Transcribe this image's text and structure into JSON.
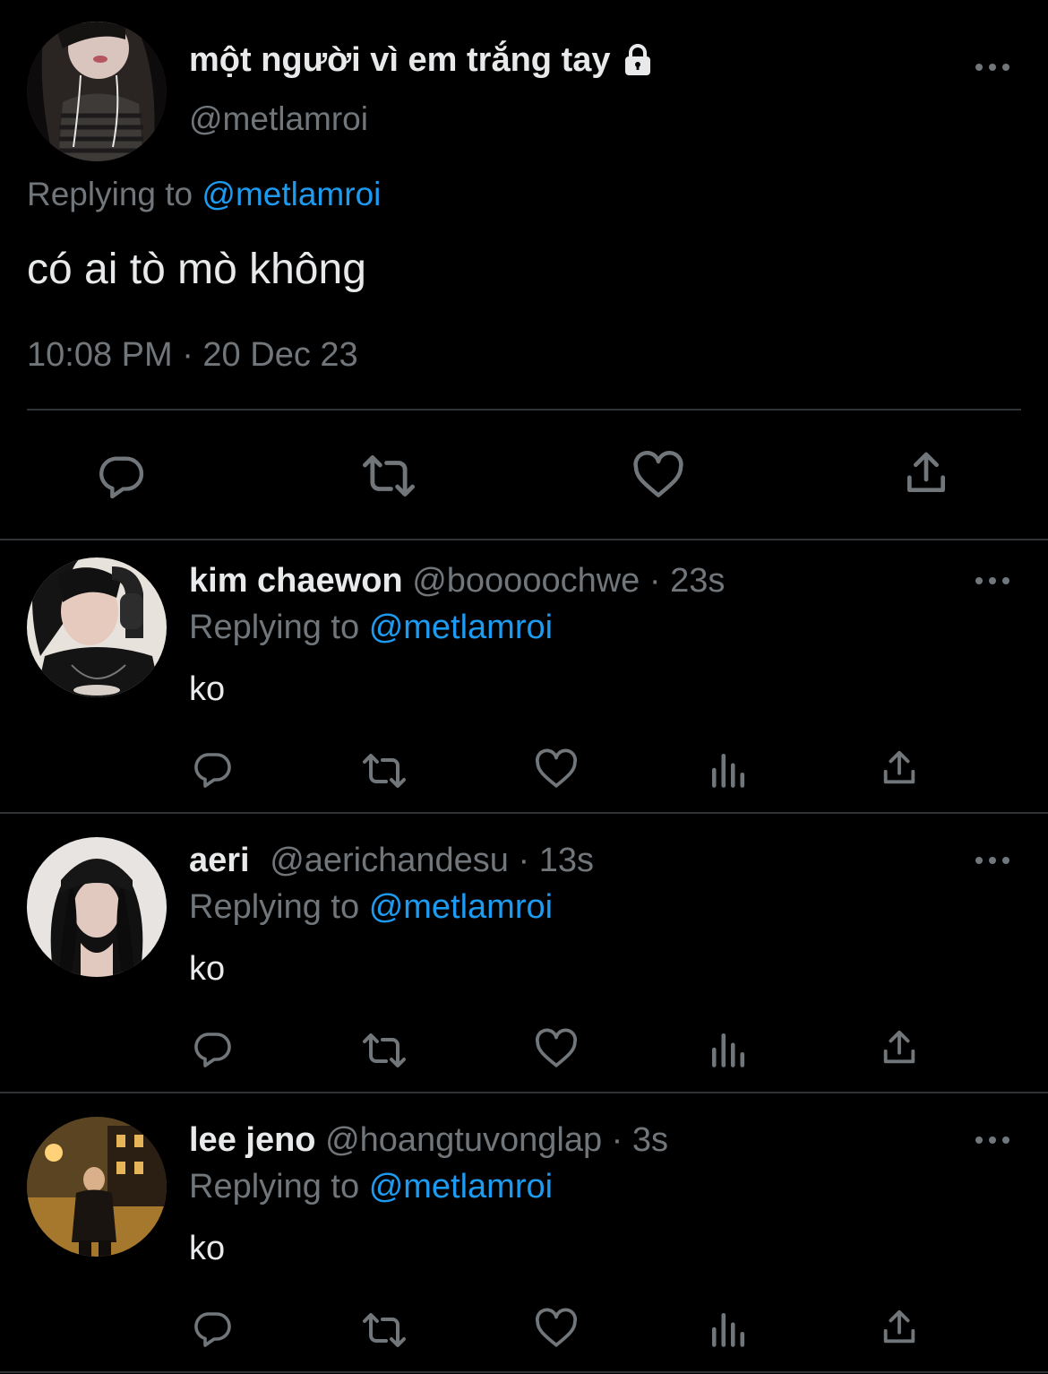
{
  "main_tweet": {
    "display_name": "một người vì em trắng tay",
    "handle": "@metlamroi",
    "replying_prefix": "Replying to",
    "replying_handle": "@metlamroi",
    "text": "có ai tò mò không",
    "timestamp": "10:08 PM · 20 Dec 23",
    "icons": [
      "reply-icon",
      "retweet-icon",
      "like-icon",
      "share-icon"
    ]
  },
  "replies": [
    {
      "display_name": "kim chaewon",
      "handle": "@booooochwe",
      "time": "· 23s",
      "replying_prefix": "Replying to",
      "replying_handle": "@metlamroi",
      "text": "ko"
    },
    {
      "display_name": "aeri",
      "handle": "@aerichandesu",
      "time": "· 13s",
      "replying_prefix": "Replying to",
      "replying_handle": "@metlamroi",
      "text": "ko"
    },
    {
      "display_name": "lee jeno",
      "handle": "@hoangtuvonglap",
      "time": "· 3s",
      "replying_prefix": "Replying to",
      "replying_handle": "@metlamroi",
      "text": "ko"
    }
  ],
  "reply_action_icons": [
    "reply-icon",
    "retweet-icon",
    "like-icon",
    "views-icon",
    "share-icon"
  ],
  "colors": {
    "background": "#000000",
    "text": "#e7e9ea",
    "muted": "#71767b",
    "link": "#1d9bf0",
    "divider": "#2f3336"
  }
}
